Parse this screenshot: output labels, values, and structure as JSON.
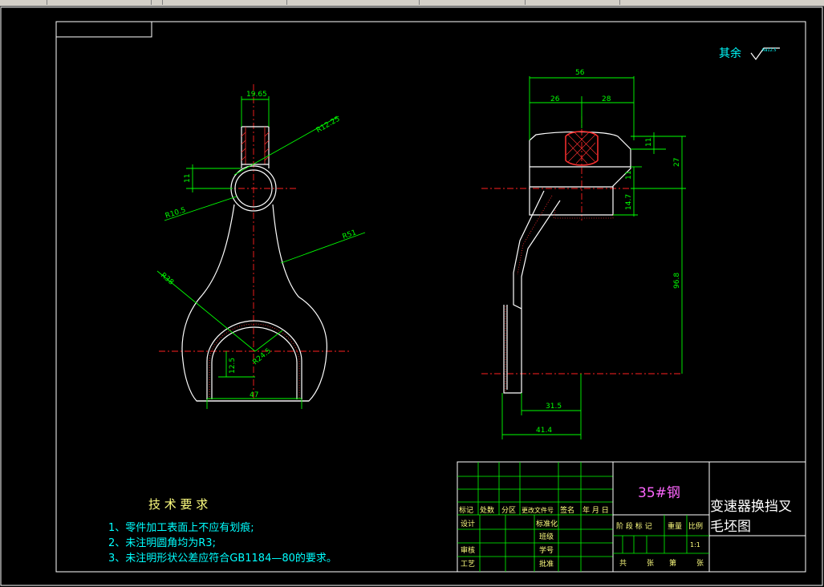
{
  "surface_note": {
    "label": "其余",
    "roughness": "Ra12.5"
  },
  "dims_front": {
    "top_width": "19.65",
    "hole_r": "R12.25",
    "neck_h": "11",
    "r_small": "R10.5",
    "r51": "R51",
    "r38": "R38",
    "r24": "R24.5",
    "h125": "12.5",
    "w47": "47"
  },
  "dims_side": {
    "total": "56",
    "left": "26",
    "right": "28",
    "d11": "11",
    "d27": "27",
    "d11b": "11",
    "d147": "14.7",
    "d968": "96.8",
    "d315": "31.5",
    "d414": "41.4"
  },
  "tech": {
    "title": "技 术 要 求",
    "items": [
      "1、零件加工表面上不应有划痕;",
      "2、未注明圆角均为R3;",
      "3、未注明形状公差应符合GB1184—80的要求。"
    ]
  },
  "title_block": {
    "material": "35#钢",
    "part_name_1": "变速器换挡叉",
    "part_name_2": "毛坯图",
    "col_labels": [
      "标记",
      "处数",
      "分区",
      "更改文件号",
      "签名",
      "年 月 日"
    ],
    "row_design": "设计",
    "row_standard": "标准化",
    "row_check": "审核",
    "row_process": "工艺",
    "row_class": "班级",
    "row_id": "学号",
    "row_approve": "批准",
    "stage_labels": [
      "阶 段 标 记",
      "重量",
      "比例"
    ],
    "scale": "1:1",
    "sheet": [
      "共",
      "张",
      "第",
      "张"
    ]
  }
}
